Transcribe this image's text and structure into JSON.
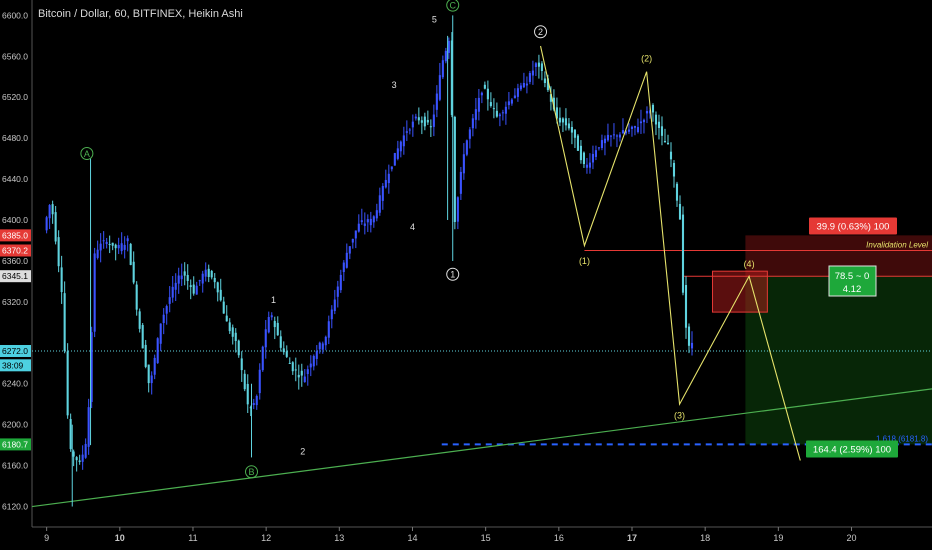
{
  "chart_data": {
    "type": "candlestick",
    "title": "Bitcoin / Dollar, 60, BITFINEX, Heikin Ashi",
    "y_ticks": [
      6120,
      6160,
      6200,
      6240,
      6280,
      6320,
      6360,
      6400,
      6440,
      6480,
      6520,
      6560,
      6600
    ],
    "y_tick_labels": [
      "6120.0",
      "6160.0",
      "6200.0",
      "6240.0",
      "",
      "6320.0",
      "6360.0",
      "6400.0",
      "6440.0",
      "6480.0",
      "6520.0",
      "6560.0",
      "6600.0"
    ],
    "ylim": [
      6100,
      6615
    ],
    "x_ticks": [
      9,
      10,
      11,
      12,
      13,
      14,
      15,
      16,
      17,
      18,
      19,
      20
    ],
    "x_bold_ticks": [
      10,
      17
    ],
    "xlim": [
      8.8,
      21.1
    ],
    "colors": {
      "up": "#3a53ff",
      "down": "#5fd3df",
      "wave": "#e6e36b",
      "trend": "#4caf50",
      "label_green": "#4caf50",
      "price_line": "#61d4df"
    },
    "price_path": [
      [
        9.0,
        6390
      ],
      [
        9.1,
        6420
      ],
      [
        9.25,
        6330
      ],
      [
        9.35,
        6175
      ],
      [
        9.5,
        6162
      ],
      [
        9.6,
        6190
      ],
      [
        9.7,
        6370
      ],
      [
        9.85,
        6380
      ],
      [
        10.0,
        6372
      ],
      [
        10.15,
        6380
      ],
      [
        10.3,
        6300
      ],
      [
        10.45,
        6235
      ],
      [
        10.6,
        6300
      ],
      [
        10.75,
        6330
      ],
      [
        10.9,
        6350
      ],
      [
        11.05,
        6330
      ],
      [
        11.2,
        6350
      ],
      [
        11.35,
        6340
      ],
      [
        11.5,
        6300
      ],
      [
        11.65,
        6275
      ],
      [
        11.8,
        6215
      ],
      [
        11.9,
        6220
      ],
      [
        12.0,
        6280
      ],
      [
        12.1,
        6310
      ],
      [
        12.25,
        6275
      ],
      [
        12.4,
        6255
      ],
      [
        12.55,
        6245
      ],
      [
        12.7,
        6270
      ],
      [
        12.85,
        6285
      ],
      [
        13.0,
        6330
      ],
      [
        13.15,
        6370
      ],
      [
        13.3,
        6395
      ],
      [
        13.5,
        6400
      ],
      [
        13.7,
        6445
      ],
      [
        13.9,
        6480
      ],
      [
        14.1,
        6500
      ],
      [
        14.3,
        6490
      ],
      [
        14.45,
        6555
      ],
      [
        14.55,
        6580
      ],
      [
        14.62,
        6400
      ],
      [
        14.75,
        6470
      ],
      [
        14.9,
        6505
      ],
      [
        15.0,
        6530
      ],
      [
        15.2,
        6500
      ],
      [
        15.4,
        6520
      ],
      [
        15.6,
        6535
      ],
      [
        15.75,
        6555
      ],
      [
        15.9,
        6525
      ],
      [
        16.0,
        6500
      ],
      [
        16.2,
        6490
      ],
      [
        16.4,
        6450
      ],
      [
        16.55,
        6470
      ],
      [
        16.7,
        6480
      ],
      [
        16.9,
        6485
      ],
      [
        17.1,
        6490
      ],
      [
        17.3,
        6510
      ],
      [
        17.45,
        6480
      ],
      [
        17.55,
        6470
      ],
      [
        17.7,
        6400
      ],
      [
        17.75,
        6310
      ],
      [
        17.82,
        6275
      ]
    ],
    "horizontal_lines": [
      {
        "value": 6370.2,
        "x_from": 16.35,
        "x_to": 21.1,
        "color": "#e53935"
      },
      {
        "value": 6345.1,
        "x_from": 17.7,
        "x_to": 21.1,
        "color": "#e53935"
      },
      {
        "value": 6272.0,
        "x_from": 8.8,
        "x_to": 21.1,
        "color": "#61d4df",
        "dotted": true
      },
      {
        "value": 6180.7,
        "x_from": 14.4,
        "x_to": 21.1,
        "color": "#2962ff",
        "dashed": true
      }
    ],
    "trendline": [
      [
        8.8,
        6120
      ],
      [
        21.1,
        6235
      ]
    ],
    "wave_lines": [
      [
        [
          15.75,
          6570
        ],
        [
          16.35,
          6375
        ],
        [
          17.2,
          6545
        ],
        [
          17.65,
          6220
        ],
        [
          18.6,
          6345
        ],
        [
          19.3,
          6165
        ]
      ]
    ],
    "wave_labels": [
      {
        "text": "(1)",
        "x": 16.35,
        "y": 6360,
        "style": "yellow"
      },
      {
        "text": "(2)",
        "x": 17.2,
        "y": 6558,
        "style": "yellow"
      },
      {
        "text": "(3)",
        "x": 17.65,
        "y": 6209,
        "style": "yellow"
      },
      {
        "text": "(4)",
        "x": 18.6,
        "y": 6357,
        "style": "yellow"
      },
      {
        "text": "1",
        "x": 14.55,
        "y": 6347,
        "style": "circle-white"
      },
      {
        "text": "2",
        "x": 15.75,
        "y": 6584,
        "style": "circle-white"
      },
      {
        "text": "A",
        "x": 9.55,
        "y": 6465,
        "style": "circle-green"
      },
      {
        "text": "B",
        "x": 11.8,
        "y": 6154,
        "style": "circle-green"
      },
      {
        "text": "C",
        "x": 14.55,
        "y": 6610,
        "style": "circle-green"
      },
      {
        "text": "1",
        "x": 12.1,
        "y": 6322,
        "style": "plain-white"
      },
      {
        "text": "2",
        "x": 12.5,
        "y": 6174,
        "style": "plain-white"
      },
      {
        "text": "3",
        "x": 13.75,
        "y": 6532,
        "style": "plain-white"
      },
      {
        "text": "4",
        "x": 14.0,
        "y": 6393,
        "style": "plain-white"
      },
      {
        "text": "5",
        "x": 14.3,
        "y": 6596,
        "style": "plain-white"
      }
    ],
    "position_box": {
      "entry": 6345.1,
      "stop": 6385.0,
      "target": 6180.7,
      "x_from": 18.55,
      "x_to": 21.1,
      "stop_label": "39.9 (0.63%) 100",
      "target_label": "164.4 (2.59%) 100",
      "rr_label_1": "78.5 ~ 0",
      "rr_label_2": "4.12"
    },
    "red_zone": {
      "x_from": 18.1,
      "x_to": 18.85,
      "y_from": 6310,
      "y_to": 6350
    },
    "invalidation_label": "Invalidation Level",
    "blue_line_label": "1.618 (6181.8)",
    "axis_badges": [
      {
        "text": "6385.0",
        "value": 6385.0,
        "bg": "#e53935",
        "fg": "#ffffff"
      },
      {
        "text": "6370.2",
        "value": 6370.2,
        "bg": "#e53935",
        "fg": "#ffffff"
      },
      {
        "text": "6345.1",
        "value": 6345.1,
        "bg": "#dddddd",
        "fg": "#000000"
      },
      {
        "text": "6272.0",
        "value": 6272.0,
        "bg": "#4dd0e1",
        "fg": "#000000"
      },
      {
        "text": "38:09",
        "value": 6258.0,
        "bg": "#4dd0e1",
        "fg": "#000000"
      },
      {
        "text": "6180.7",
        "value": 6180.7,
        "bg": "#1ea83a",
        "fg": "#ffffff"
      }
    ]
  }
}
